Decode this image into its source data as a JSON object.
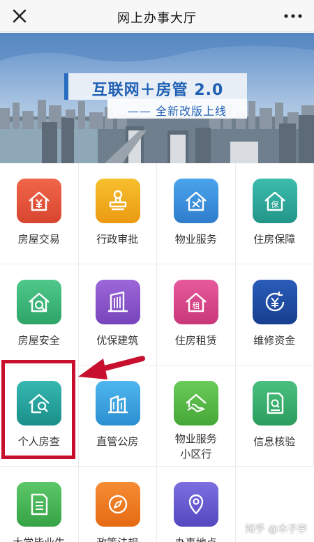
{
  "header": {
    "title": "网上办事大厅",
    "close_icon": "close-icon",
    "more_icon": "more-icon"
  },
  "banner": {
    "slogan": "互联网＋房管 2.0",
    "subslogan": "—— 全新改版上线"
  },
  "services": [
    {
      "label": "房屋交易",
      "icon": "house-yuan-icon",
      "color": "#e0543a"
    },
    {
      "label": "行政审批",
      "icon": "stamp-icon",
      "color": "#f0a71b"
    },
    {
      "label": "物业服务",
      "icon": "house-tools-icon",
      "color": "#3a8fd8"
    },
    {
      "label": "住房保障",
      "icon": "house-shield-icon",
      "color": "#2fa89a"
    },
    {
      "label": "房屋安全",
      "icon": "house-safety-icon",
      "color": "#3eb47b"
    },
    {
      "label": "优保建筑",
      "icon": "building-icon",
      "color": "#8a55c9"
    },
    {
      "label": "住房租赁",
      "icon": "house-rent-icon",
      "color": "#d94a8c"
    },
    {
      "label": "维修资金",
      "icon": "yuan-cycle-icon",
      "color": "#1e4fa6"
    },
    {
      "label": "个人房查",
      "icon": "house-search-icon",
      "color": "#26a39d"
    },
    {
      "label": "直管公房",
      "icon": "public-house-icon",
      "color": "#3aa3e0"
    },
    {
      "label": "物业服务\n小区行",
      "icon": "community-icon",
      "color": "#5bbb4a"
    },
    {
      "label": "信息核验",
      "icon": "document-check-icon",
      "color": "#3cad6f"
    },
    {
      "label": "大学毕业生",
      "icon": "document-icon",
      "color": "#4cb85a"
    },
    {
      "label": "政策法规",
      "icon": "compass-icon",
      "color": "#f07a22"
    },
    {
      "label": "办事地点",
      "icon": "location-icon",
      "color": "#6a5fd2"
    }
  ],
  "watermark": "知乎 @木子李"
}
